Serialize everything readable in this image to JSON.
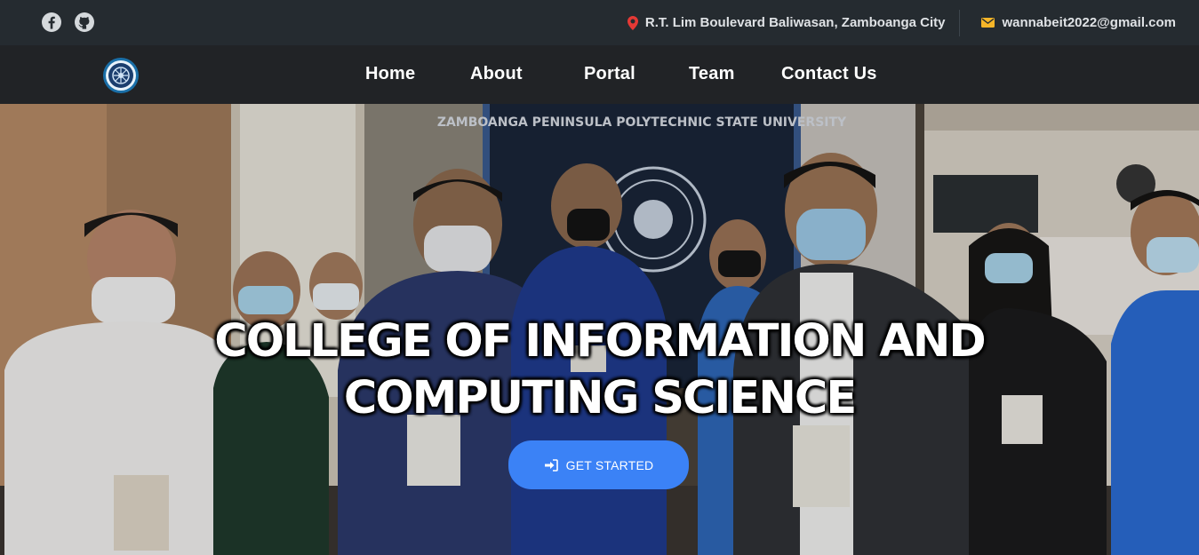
{
  "topbar": {
    "social": [
      {
        "icon": "facebook-icon"
      },
      {
        "icon": "github-icon"
      }
    ],
    "address": "R.T. Lim Boulevard Baliwasan, Zamboanga City",
    "email": "wannabeit2022@gmail.com",
    "pin_color": "#e53935",
    "mail_color": "#f5b528"
  },
  "nav": {
    "logo": "college-seal-icon",
    "items": [
      {
        "label": "Home"
      },
      {
        "label": "About"
      },
      {
        "label": "Portal"
      },
      {
        "label": "Team"
      },
      {
        "label": "Contact Us"
      }
    ]
  },
  "hero": {
    "title_line1": "COLLEGE OF INFORMATION AND",
    "title_line2": "COMPUTING SCIENCE",
    "cta_label": "GET STARTED",
    "cta_icon": "sign-in-icon",
    "cta_color": "#3b82f6",
    "banner_text": "ZAMBOANGA PENINSULA POLYTECHNIC STATE UNIVERSITY"
  }
}
